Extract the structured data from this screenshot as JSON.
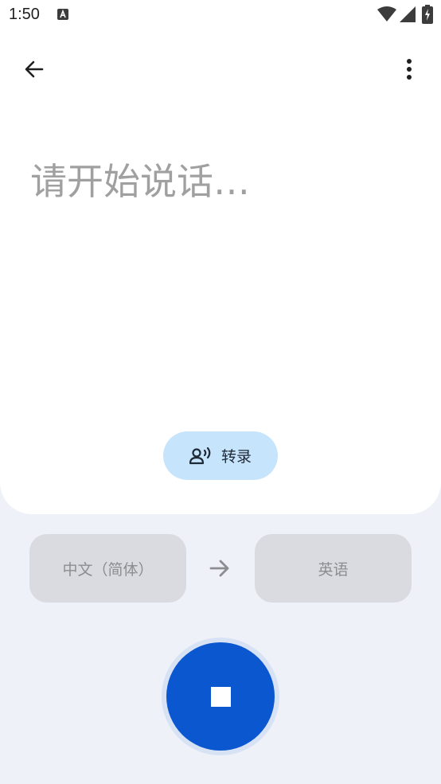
{
  "status_bar": {
    "time": "1:50",
    "icons": [
      "text-a-icon",
      "wifi-icon",
      "signal-icon",
      "battery-charging-icon"
    ]
  },
  "toolbar": {
    "back_icon": "arrow-left-icon",
    "more_icon": "more-vertical-icon"
  },
  "main": {
    "prompt": "请开始说话…"
  },
  "transcribe": {
    "icon": "voice-person-icon",
    "label": "转录",
    "color": "#c6e4fb"
  },
  "languages": {
    "source": "中文（简体）",
    "target": "英语",
    "swap_icon": "arrow-right-icon"
  },
  "stop": {
    "icon": "stop-icon",
    "color": "#0b57d0"
  }
}
